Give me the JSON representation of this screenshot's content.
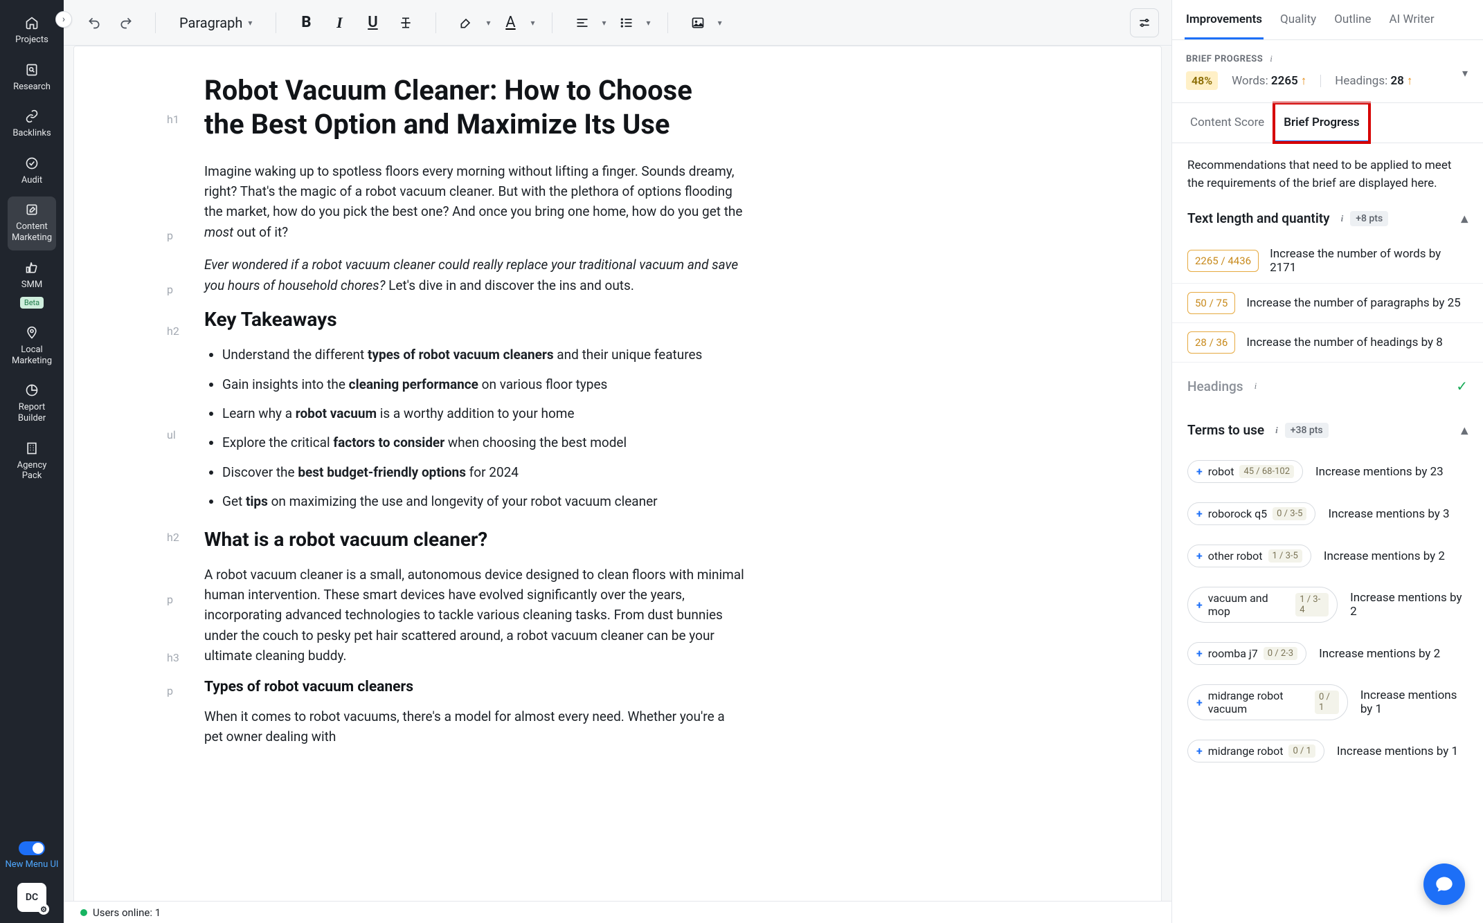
{
  "left_nav": {
    "expand_icon": "›",
    "items": [
      {
        "label": "Projects",
        "icon": "home"
      },
      {
        "label": "Research",
        "icon": "search-page"
      },
      {
        "label": "Backlinks",
        "icon": "link"
      },
      {
        "label": "Audit",
        "icon": "check-circle"
      },
      {
        "label": "Content Marketing",
        "icon": "edit",
        "active": true
      },
      {
        "label": "SMM",
        "icon": "thumbs-up",
        "beta": "Beta"
      },
      {
        "label": "Local Marketing",
        "icon": "pin"
      },
      {
        "label": "Report Builder",
        "icon": "pie"
      },
      {
        "label": "Agency Pack",
        "icon": "building"
      }
    ],
    "toggle_label": "New Menu UI",
    "avatar": "DC"
  },
  "toolbar": {
    "paragraph_label": "Paragraph"
  },
  "document": {
    "h1": "Robot Vacuum Cleaner: How to Choose the Best Option and Maximize Its Use",
    "p1_a": "Imagine waking up to spotless floors every morning without lifting a finger. Sounds dreamy, right? That's the magic of a robot vacuum cleaner. But with the plethora of options flooding the market, how do you pick the best one? And once you bring one home, how do you get the ",
    "p1_em": "most",
    "p1_b": " out of it?",
    "p2_em": "Ever wondered if a robot vacuum cleaner could really replace your traditional vacuum and save you hours of household chores?",
    "p2_b": " Let's dive in and discover the ins and outs.",
    "h2_1": "Key Takeaways",
    "li1_a": "Understand the different ",
    "li1_b": "types of robot vacuum cleaners",
    "li1_c": " and their unique features",
    "li2_a": "Gain insights into the ",
    "li2_b": "cleaning performance",
    "li2_c": " on various floor types",
    "li3_a": "Learn why a ",
    "li3_b": "robot vacuum",
    "li3_c": " is a worthy addition to your home",
    "li4_a": "Explore the critical ",
    "li4_b": "factors to consider",
    "li4_c": " when choosing the best model",
    "li5_a": "Discover the ",
    "li5_b": "best budget-friendly options",
    "li5_c": " for 2024",
    "li6_a": "Get ",
    "li6_b": "tips",
    "li6_c": " on maximizing the use and longevity of your robot vacuum cleaner",
    "h2_2": "What is a robot vacuum cleaner?",
    "p3": "A robot vacuum cleaner is a small, autonomous device designed to clean floors with minimal human intervention. These smart devices have evolved significantly over the years, incorporating advanced technologies to tackle various cleaning tasks. From dust bunnies under the couch to pesky pet hair scattered around, a robot vacuum cleaner can be your ultimate cleaning buddy.",
    "h3_1": "Types of robot vacuum cleaners",
    "p4": "When it comes to robot vacuums, there's a model for almost every need. Whether you're a pet owner dealing with",
    "gutter": {
      "h1": "h1",
      "p": "p",
      "h2": "h2",
      "ul": "ul",
      "h3": "h3"
    }
  },
  "footer": {
    "users_online": "Users online: 1"
  },
  "right": {
    "tabs": [
      "Improvements",
      "Quality",
      "Outline",
      "AI Writer"
    ],
    "brief_label": "BRIEF PROGRESS",
    "pct": "48%",
    "words_label": "Words:",
    "words_value": "2265",
    "headings_label": "Headings:",
    "headings_value": "28",
    "subtabs": {
      "content_score": "Content Score",
      "brief_progress": "Brief Progress"
    },
    "desc": "Recommendations that need to be applied to meet the requirements of the brief are displayed here.",
    "section_text_length": "Text length and quantity",
    "section_text_length_pts": "+8 pts",
    "metrics": [
      {
        "pill": "2265 / 4436",
        "text": "Increase the number of words by 2171"
      },
      {
        "pill": "50 / 75",
        "text": "Increase the number of paragraphs by 25"
      },
      {
        "pill": "28 / 36",
        "text": "Increase the number of headings by 8"
      }
    ],
    "section_headings": "Headings",
    "section_terms": "Terms to use",
    "section_terms_pts": "+38 pts",
    "terms": [
      {
        "name": "robot",
        "count": "45 / 68-102",
        "text": "Increase mentions by 23"
      },
      {
        "name": "roborock q5",
        "count": "0 / 3-5",
        "text": "Increase mentions by 3"
      },
      {
        "name": "other robot",
        "count": "1 / 3-5",
        "text": "Increase mentions by 2"
      },
      {
        "name": "vacuum and mop",
        "count": "1 / 3-4",
        "text": "Increase mentions by 2"
      },
      {
        "name": "roomba j7",
        "count": "0 / 2-3",
        "text": "Increase mentions by 2"
      },
      {
        "name": "midrange robot vacuum",
        "count": "0 / 1",
        "text": "Increase mentions by 1"
      },
      {
        "name": "midrange robot",
        "count": "0 / 1",
        "text": "Increase mentions by 1"
      }
    ]
  }
}
